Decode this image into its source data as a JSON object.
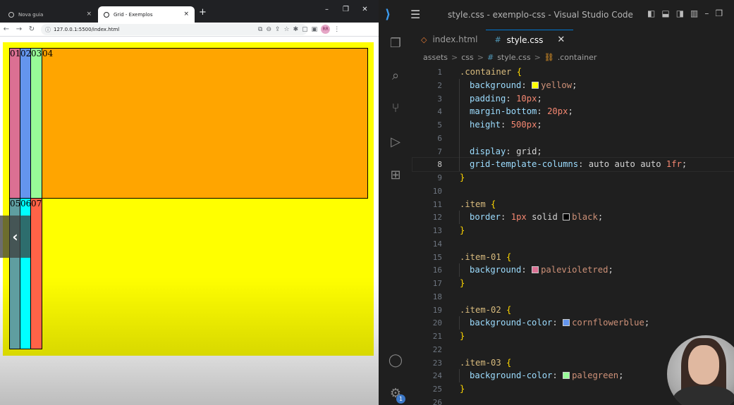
{
  "browser": {
    "tabs": [
      {
        "title": "Nova guia",
        "close": "×"
      },
      {
        "title": "Grid - Exemplos",
        "close": "×"
      }
    ],
    "new_tab": "+",
    "window_controls": [
      "–",
      "❐",
      "✕"
    ],
    "nav": {
      "back": "←",
      "forward": "→",
      "reload": "↻"
    },
    "url": "127.0.0.1:5500/index.html",
    "url_info": "ⓘ",
    "toolbar_icons": [
      "⧉",
      "⊖",
      "⇪",
      "☆",
      "✱",
      "▢",
      "▣",
      "⋮"
    ],
    "avatar_text": "RR",
    "page": {
      "items": [
        "01",
        "02",
        "03",
        "04",
        "05",
        "06",
        "07"
      ],
      "colors": {
        "container": "#ffff00",
        "item-01": "#db7093",
        "item-02": "#6495ed",
        "item-03": "#98fb98",
        "item-04": "#ffa500",
        "item-05": "#5f9ea0",
        "item-06": "#00ffff",
        "item-07": "#ff6347"
      }
    },
    "prev_arrow": "‹"
  },
  "vscode": {
    "title": "style.css - exemplo-css - Visual Studio Code",
    "tabs": [
      {
        "icon": "◇",
        "label": "index.html"
      },
      {
        "icon": "#",
        "label": "style.css",
        "close": "✕"
      }
    ],
    "breadcrumb": [
      "assets",
      "css",
      "style.css",
      ".container"
    ],
    "breadcrumb_sep": ">",
    "badge": "1",
    "lines": [
      {
        "n": "1",
        "text": ".container {"
      },
      {
        "n": "2",
        "text": "background: yellow;"
      },
      {
        "n": "3",
        "text": "padding: 10px;"
      },
      {
        "n": "4",
        "text": "margin-bottom: 20px;"
      },
      {
        "n": "5",
        "text": "height: 500px;"
      },
      {
        "n": "6",
        "text": ""
      },
      {
        "n": "7",
        "text": "display: grid;"
      },
      {
        "n": "8",
        "text": "grid-template-columns: auto auto auto 1fr;"
      },
      {
        "n": "9",
        "text": "}"
      },
      {
        "n": "10",
        "text": ""
      },
      {
        "n": "11",
        "text": ".item {"
      },
      {
        "n": "12",
        "text": "border: 1px solid black;"
      },
      {
        "n": "13",
        "text": "}"
      },
      {
        "n": "14",
        "text": ""
      },
      {
        "n": "15",
        "text": ".item-01 {"
      },
      {
        "n": "16",
        "text": "background: palevioletred;"
      },
      {
        "n": "17",
        "text": "}"
      },
      {
        "n": "18",
        "text": ""
      },
      {
        "n": "19",
        "text": ".item-02 {"
      },
      {
        "n": "20",
        "text": "background-color: cornflowerblue;"
      },
      {
        "n": "21",
        "text": "}"
      },
      {
        "n": "22",
        "text": ""
      },
      {
        "n": "23",
        "text": ".item-03 {"
      },
      {
        "n": "24",
        "text": "background-color: palegreen;"
      },
      {
        "n": "25",
        "text": "}"
      },
      {
        "n": "26",
        "text": ""
      }
    ],
    "active_line": "8",
    "swatches": {
      "yellow": "#ffff00",
      "black": "#000000",
      "palevioletred": "#db7093",
      "cornflowerblue": "#6495ed",
      "palegreen": "#98fb98"
    }
  }
}
